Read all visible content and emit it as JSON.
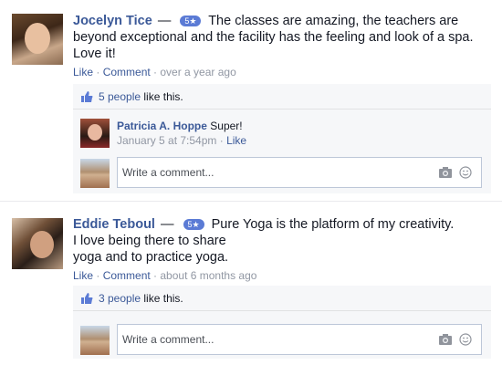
{
  "reviews": [
    {
      "author": "Jocelyn Tice",
      "dash": "—",
      "rating": "5★",
      "text": "The classes are amazing, the teachers are beyond exceptional and the facility has the feeling and look of a spa. Love it!",
      "like": "Like",
      "comment": "Comment",
      "time": "over a year ago",
      "likes_count": "5 people",
      "likes_suffix": "like this.",
      "reply": {
        "author": "Patricia A. Hoppe",
        "text": "Super!",
        "time": "January 5 at 7:54pm",
        "like": "Like"
      },
      "composer_placeholder": "Write a comment..."
    },
    {
      "author": "Eddie Teboul",
      "dash": "—",
      "rating": "5★",
      "text_line1": "Pure Yoga is the platform of my creativity.",
      "text_line2": "I love being there to share",
      "text_line3": "yoga and to practice yoga.",
      "like": "Like",
      "comment": "Comment",
      "time": "about 6 months ago",
      "likes_count": "3 people",
      "likes_suffix": "like this.",
      "composer_placeholder": "Write a comment..."
    }
  ],
  "icons": [
    "thumbs-up-icon",
    "camera-icon",
    "smiley-icon"
  ],
  "colors": {
    "link": "#3b5998",
    "meta": "#9197a3",
    "badge": "#5b7bd5",
    "panel": "#f6f7f9"
  }
}
